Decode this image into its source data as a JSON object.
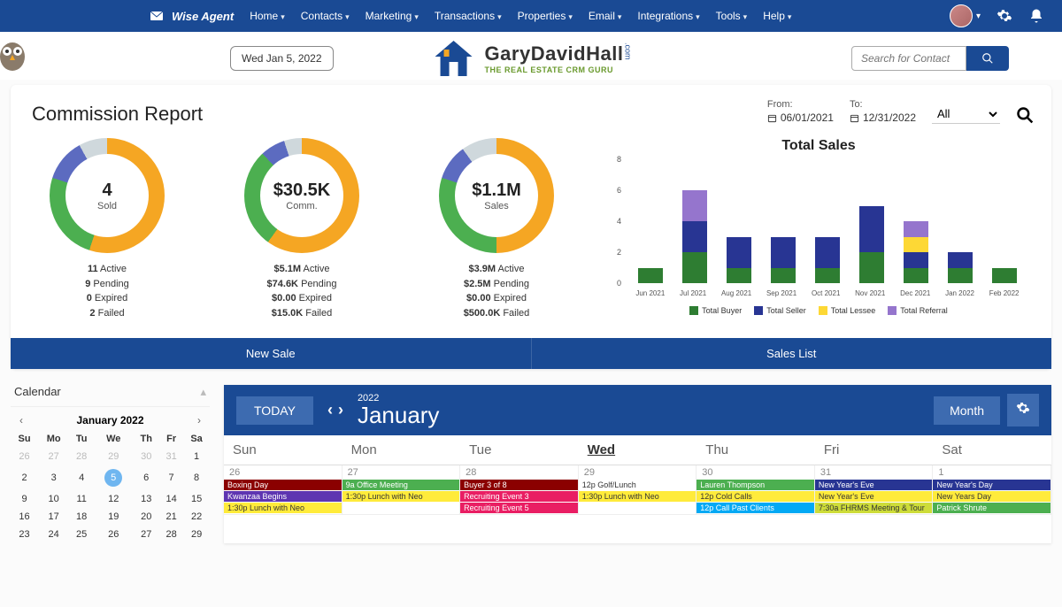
{
  "nav": {
    "brand": "Wise Agent",
    "items": [
      "Home",
      "Contacts",
      "Marketing",
      "Transactions",
      "Properties",
      "Email",
      "Integrations",
      "Tools",
      "Help"
    ]
  },
  "subheader": {
    "date": "Wed Jan 5, 2022",
    "logo_main": "GaryDavidHall",
    "logo_sub": "THE REAL ESTATE CRM GURU",
    "search_placeholder": "Search for Contact"
  },
  "report": {
    "title": "Commission Report",
    "from_label": "From:",
    "from_value": "06/01/2021",
    "to_label": "To:",
    "to_value": "12/31/2022",
    "filter": "All",
    "donuts": [
      {
        "center_big": "4",
        "center_small": "Sold",
        "stats": [
          [
            "11",
            "Active"
          ],
          [
            "9",
            "Pending"
          ],
          [
            "0",
            "Expired"
          ],
          [
            "2",
            "Failed"
          ]
        ]
      },
      {
        "center_big": "$30.5K",
        "center_small": "Comm.",
        "stats": [
          [
            "$5.1M",
            "Active"
          ],
          [
            "$74.6K",
            "Pending"
          ],
          [
            "$0.00",
            "Expired"
          ],
          [
            "$15.0K",
            "Failed"
          ]
        ]
      },
      {
        "center_big": "$1.1M",
        "center_small": "Sales",
        "stats": [
          [
            "$3.9M",
            "Active"
          ],
          [
            "$2.5M",
            "Pending"
          ],
          [
            "$0.00",
            "Expired"
          ],
          [
            "$500.0K",
            "Failed"
          ]
        ]
      }
    ],
    "bar_title": "Total Sales",
    "legend": [
      "Total Buyer",
      "Total Seller",
      "Total Lessee",
      "Total Referral"
    ],
    "actions": [
      "New Sale",
      "Sales List"
    ]
  },
  "chart_data": {
    "type": "bar",
    "title": "Total Sales",
    "ylim": [
      0,
      8
    ],
    "yticks": [
      0,
      2,
      4,
      6,
      8
    ],
    "categories": [
      "Jun 2021",
      "Jul 2021",
      "Aug 2021",
      "Sep 2021",
      "Oct 2021",
      "Nov 2021",
      "Dec 2021",
      "Jan 2022",
      "Feb 2022"
    ],
    "series": [
      {
        "name": "Total Buyer",
        "color": "#2e7d32",
        "values": [
          1,
          2,
          1,
          1,
          1,
          2,
          1,
          1,
          1
        ]
      },
      {
        "name": "Total Seller",
        "color": "#283593",
        "values": [
          0,
          2,
          2,
          2,
          2,
          3,
          1,
          1,
          0
        ]
      },
      {
        "name": "Total Lessee",
        "color": "#fdd835",
        "values": [
          0,
          0,
          0,
          0,
          0,
          0,
          1,
          0,
          0
        ]
      },
      {
        "name": "Total Referral",
        "color": "#9575cd",
        "values": [
          0,
          2,
          0,
          0,
          0,
          0,
          1,
          0,
          0
        ]
      }
    ]
  },
  "donut_slices": [
    [
      {
        "c": "#f5a623",
        "v": 55
      },
      {
        "c": "#4caf50",
        "v": 25
      },
      {
        "c": "#5c6bc0",
        "v": 12
      },
      {
        "c": "#cfd8dc",
        "v": 8
      }
    ],
    [
      {
        "c": "#f5a623",
        "v": 60
      },
      {
        "c": "#4caf50",
        "v": 28
      },
      {
        "c": "#5c6bc0",
        "v": 7
      },
      {
        "c": "#cfd8dc",
        "v": 5
      }
    ],
    [
      {
        "c": "#f5a623",
        "v": 50
      },
      {
        "c": "#4caf50",
        "v": 30
      },
      {
        "c": "#5c6bc0",
        "v": 10
      },
      {
        "c": "#cfd8dc",
        "v": 10
      }
    ]
  ],
  "mini_cal": {
    "title": "Calendar",
    "month": "January 2022",
    "dow": [
      "Su",
      "Mo",
      "Tu",
      "We",
      "Th",
      "Fr",
      "Sa"
    ],
    "weeks": [
      [
        {
          "d": 26,
          "dim": 1
        },
        {
          "d": 27,
          "dim": 1
        },
        {
          "d": 28,
          "dim": 1
        },
        {
          "d": 29,
          "dim": 1
        },
        {
          "d": 30,
          "dim": 1
        },
        {
          "d": 31,
          "dim": 1
        },
        {
          "d": 1
        }
      ],
      [
        {
          "d": 2
        },
        {
          "d": 3
        },
        {
          "d": 4
        },
        {
          "d": 5,
          "sel": 1
        },
        {
          "d": 6
        },
        {
          "d": 7
        },
        {
          "d": 8
        }
      ],
      [
        {
          "d": 9
        },
        {
          "d": 10
        },
        {
          "d": 11
        },
        {
          "d": 12
        },
        {
          "d": 13
        },
        {
          "d": 14
        },
        {
          "d": 15
        }
      ],
      [
        {
          "d": 16
        },
        {
          "d": 17
        },
        {
          "d": 18
        },
        {
          "d": 19
        },
        {
          "d": 20
        },
        {
          "d": 21
        },
        {
          "d": 22
        }
      ],
      [
        {
          "d": 23
        },
        {
          "d": 24
        },
        {
          "d": 25
        },
        {
          "d": 26
        },
        {
          "d": 27
        },
        {
          "d": 28
        },
        {
          "d": 29
        }
      ]
    ]
  },
  "big_cal": {
    "today": "TODAY",
    "year": "2022",
    "month": "January",
    "view": "Month",
    "days": [
      "Sun",
      "Mon",
      "Tue",
      "Wed",
      "Thu",
      "Fri",
      "Sat"
    ],
    "current_day_index": 3,
    "row": [
      {
        "num": "26",
        "ev": [
          {
            "t": "Boxing Day",
            "bg": "#8b0000",
            "fg": "#fff"
          },
          {
            "t": "Kwanzaa Begins",
            "bg": "#5e35b1",
            "fg": "#fff"
          },
          {
            "t": "1:30p Lunch with Neo",
            "bg": "#ffeb3b",
            "fg": "#333"
          }
        ]
      },
      {
        "num": "27",
        "ev": [
          {
            "t": "9a Office Meeting",
            "bg": "#4caf50",
            "fg": "#fff"
          },
          {
            "t": "1:30p Lunch with Neo",
            "bg": "#ffeb3b",
            "fg": "#333"
          }
        ]
      },
      {
        "num": "28",
        "ev": [
          {
            "t": "Buyer 3 of 8",
            "bg": "#8b0000",
            "fg": "#fff"
          },
          {
            "t": "Recruiting Event 3",
            "bg": "#e91e63",
            "fg": "#fff"
          },
          {
            "t": "Recruiting Event 5",
            "bg": "#e91e63",
            "fg": "#fff"
          }
        ]
      },
      {
        "num": "29",
        "ev": [
          {
            "t": "12p Golf/Lunch",
            "bg": "#fff",
            "fg": "#333"
          },
          {
            "t": "1:30p Lunch with Neo",
            "bg": "#ffeb3b",
            "fg": "#333"
          }
        ]
      },
      {
        "num": "30",
        "ev": [
          {
            "t": "Lauren Thompson",
            "bg": "#4caf50",
            "fg": "#fff"
          },
          {
            "t": "12p Cold Calls",
            "bg": "#ffeb3b",
            "fg": "#333"
          },
          {
            "t": "12p Call Past Clients",
            "bg": "#03a9f4",
            "fg": "#fff"
          }
        ]
      },
      {
        "num": "31",
        "ev": [
          {
            "t": "New Year's Eve",
            "bg": "#283593",
            "fg": "#fff"
          },
          {
            "t": "New Year's Eve",
            "bg": "#ffeb3b",
            "fg": "#333"
          },
          {
            "t": "7:30a FHRMS Meeting & Tour",
            "bg": "#cddc39",
            "fg": "#333"
          }
        ]
      },
      {
        "num": "1",
        "ev": [
          {
            "t": "New Year's Day",
            "bg": "#283593",
            "fg": "#fff"
          },
          {
            "t": "New Years Day",
            "bg": "#ffeb3b",
            "fg": "#333"
          },
          {
            "t": "Patrick Shrute",
            "bg": "#4caf50",
            "fg": "#fff"
          }
        ]
      }
    ]
  }
}
